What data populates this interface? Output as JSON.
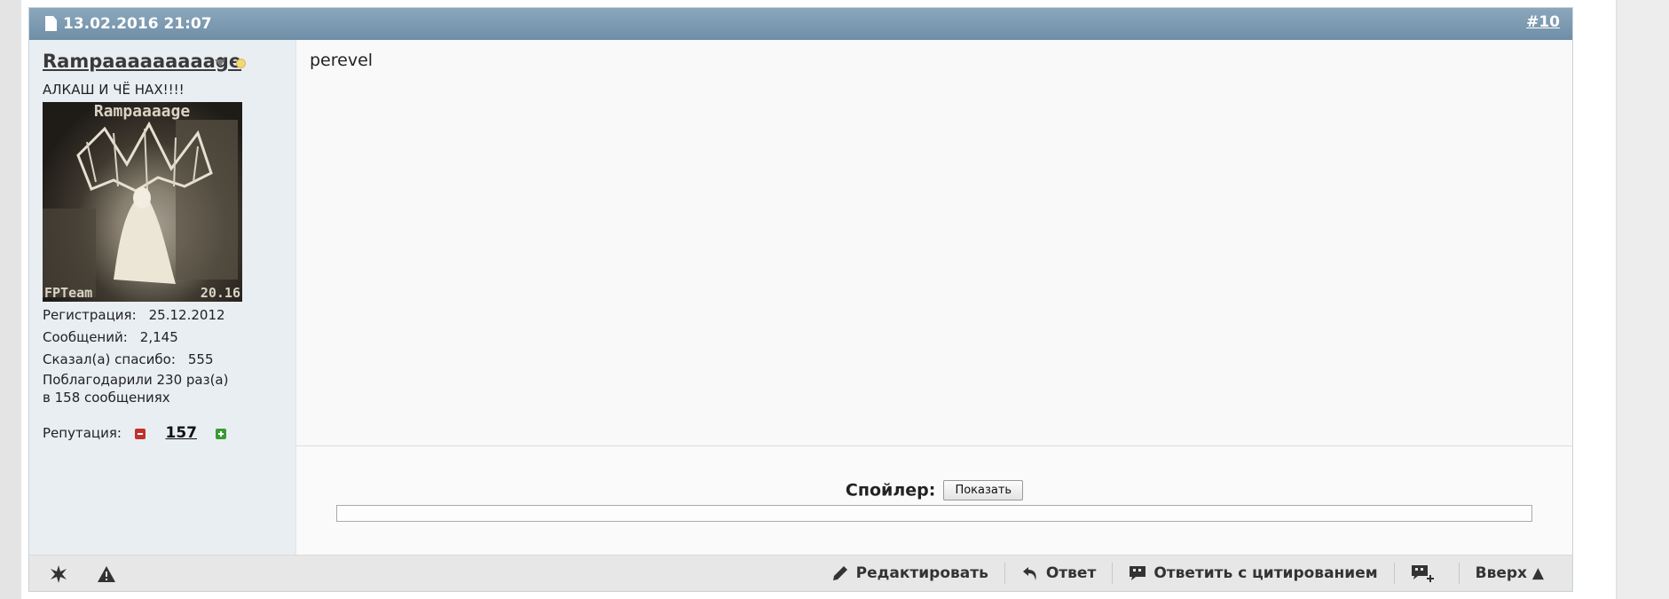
{
  "post": {
    "date": "13.02.2016 21:07",
    "number": "#10",
    "message": "perevel"
  },
  "user": {
    "name": "Rampaaaaaaaaage",
    "title": "АЛКАШ И ЧЁ НАХ!!!!",
    "avatar": {
      "top_text": "Rampaaaage",
      "bottom_left": "FPTeam",
      "bottom_right": "20.16"
    },
    "stats": [
      {
        "label": "Регистрация:",
        "value": "25.12.2012"
      },
      {
        "label": "Сообщений:",
        "value": "2,145"
      },
      {
        "label": "Сказал(а) спасибо:",
        "value": "555"
      }
    ],
    "thanks_line1": "Поблагодарили 230 раз(а)",
    "thanks_line2": "в 158 сообщениях",
    "reputation_label": "Репутация:",
    "reputation_value": "157"
  },
  "signature": {
    "spoiler_label": "Спойлер:",
    "spoiler_button": "Показать"
  },
  "footer": {
    "actions": {
      "edit": "Редактировать",
      "reply": "Ответ",
      "quote": "Ответить с цитированием",
      "top": "Вверх ▲"
    }
  },
  "colors": {
    "header_bg": "#7b98af",
    "userinfo_bg": "#e9eef3",
    "rep_minus": "#c0322b",
    "rep_plus": "#3b9b32"
  },
  "icons": {
    "header": "document-icon",
    "footer_left": [
      "star-icon",
      "warning-icon"
    ],
    "edit": "pencil-icon",
    "reply": "reply-arrow-icon",
    "quote": "quote-bubble-icon",
    "multiquote": "multiquote-add-icon"
  }
}
